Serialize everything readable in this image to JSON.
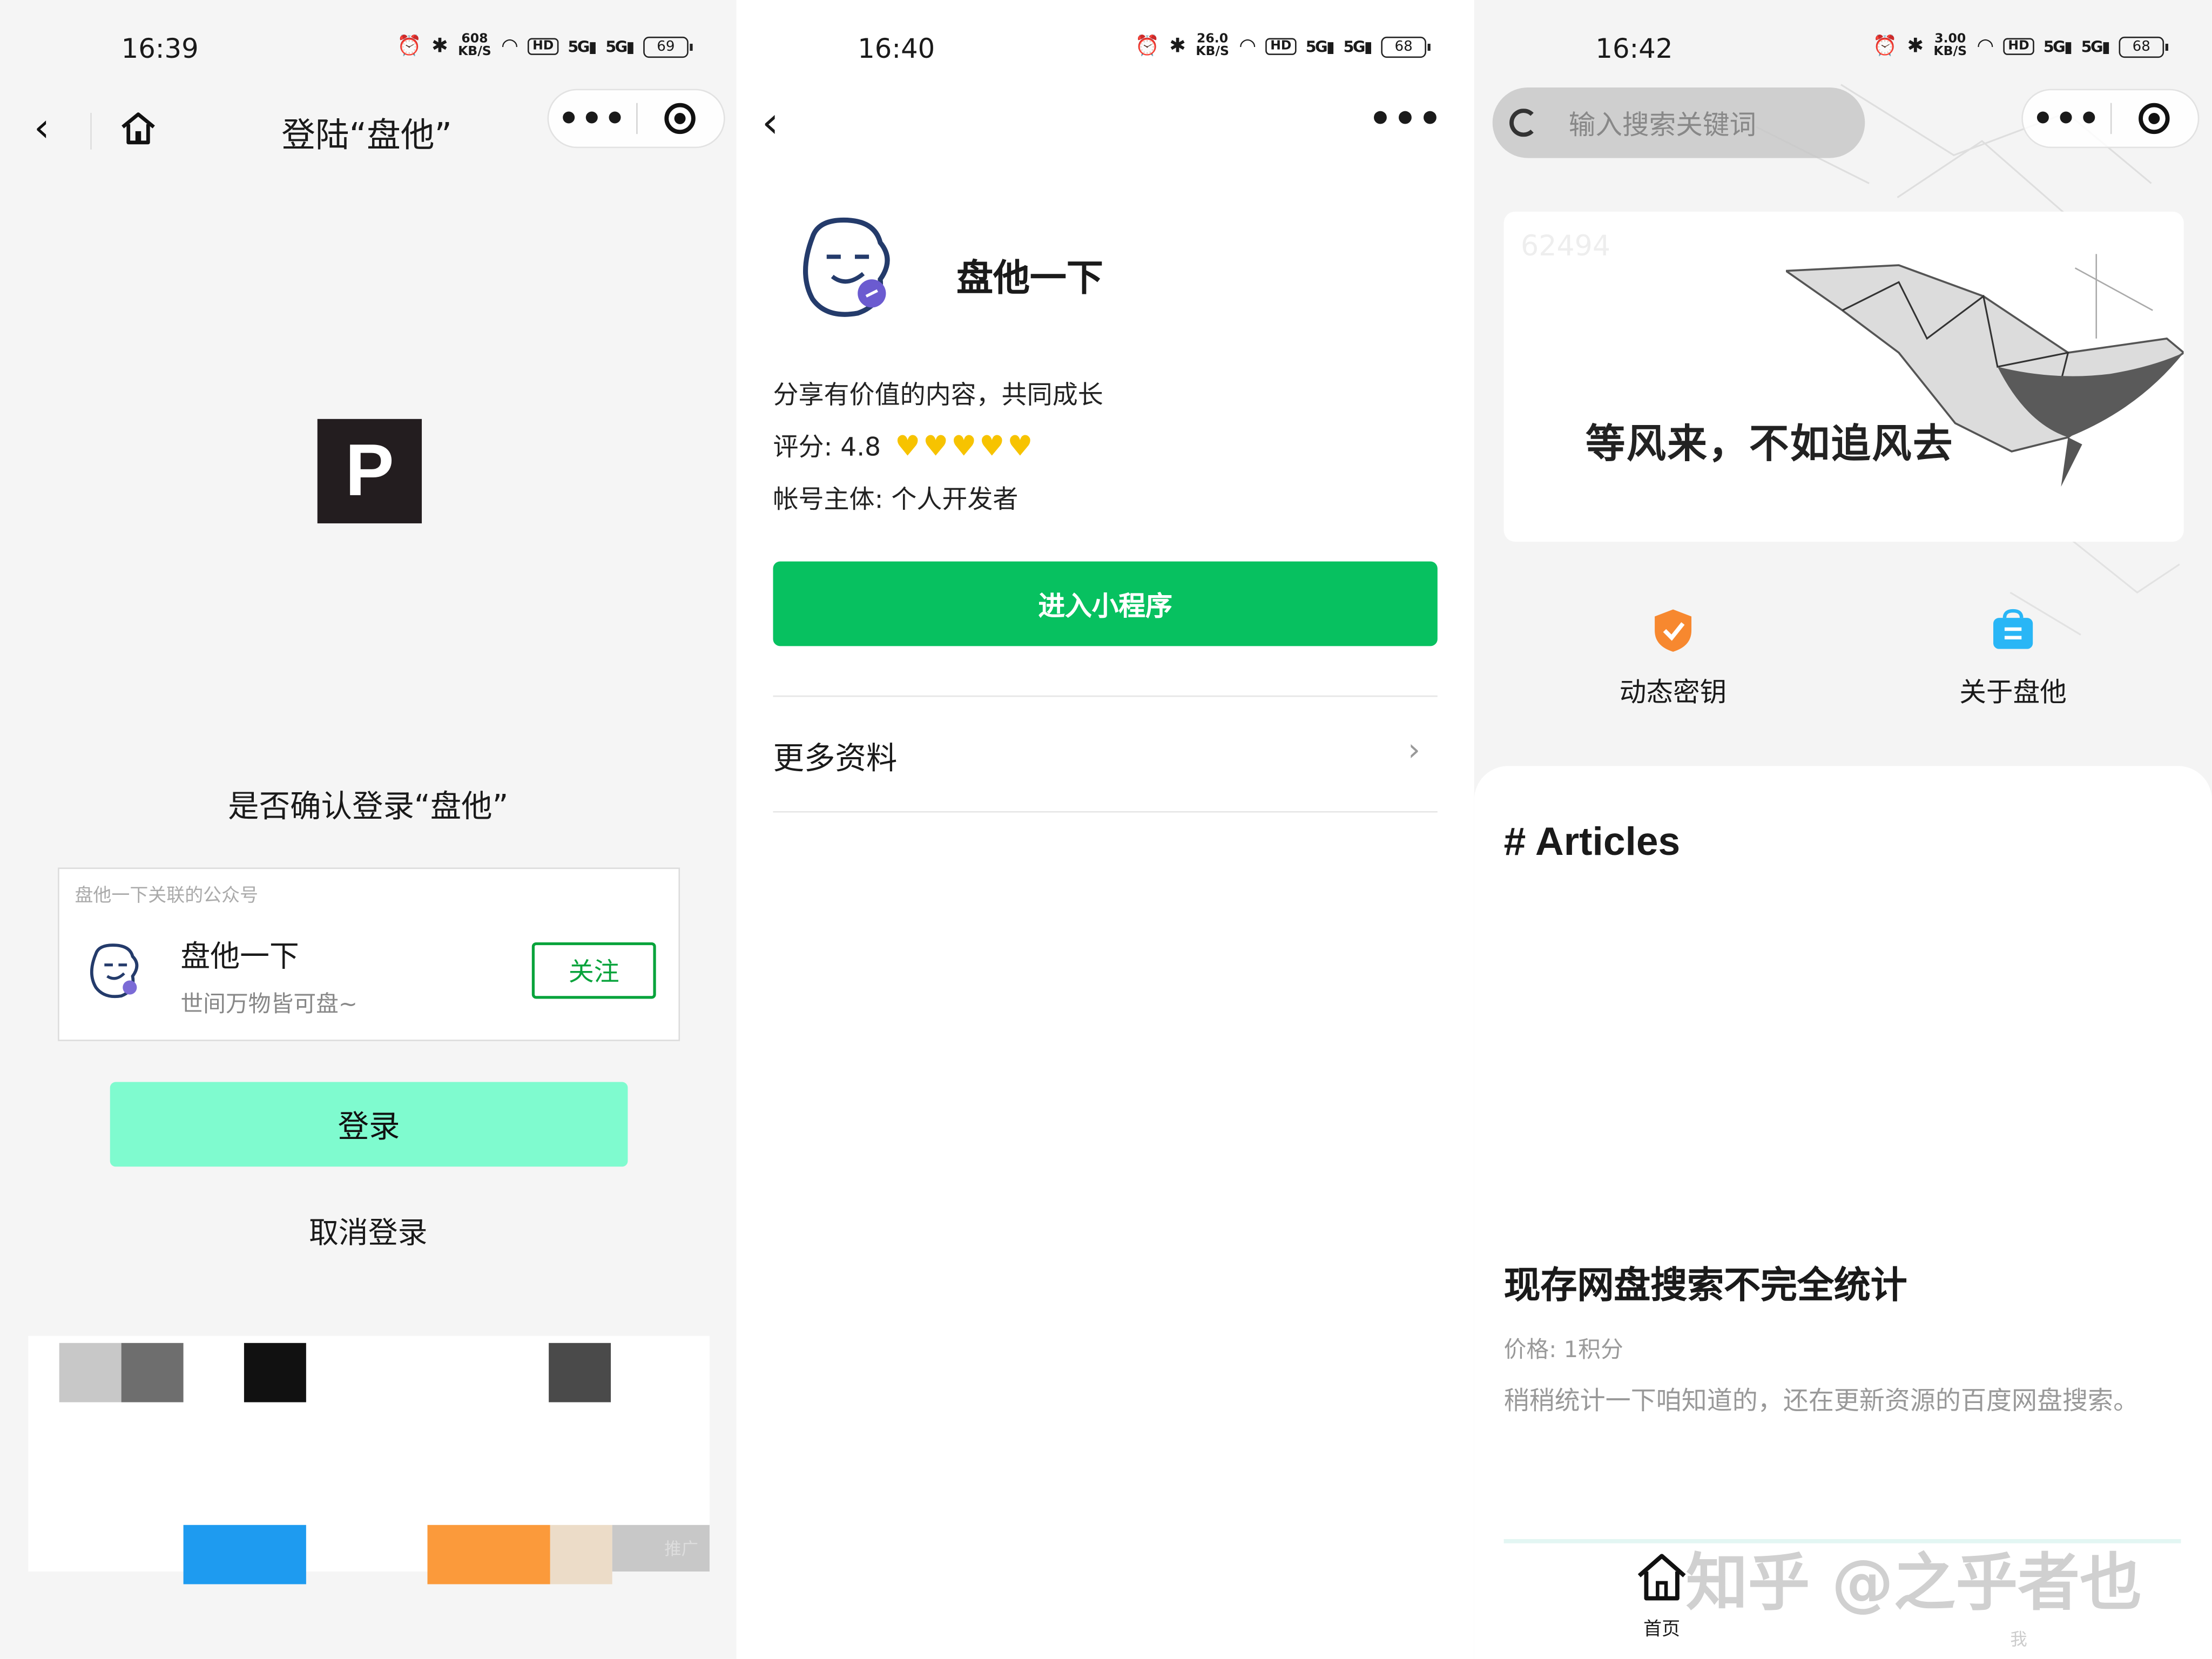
{
  "panel1": {
    "status": {
      "time": "16:39",
      "speed_top": "608",
      "speed_unit": "KB/S",
      "hd": "HD",
      "sig1": "5G",
      "sig2": "5G",
      "battery": "69"
    },
    "title": "登陆“盘他”",
    "logo_letter": "P",
    "confirm_text": "是否确认登录“盘他”",
    "account_card": {
      "header": "盘他一下关联的公众号",
      "name": "盘他一下",
      "desc": "世间万物皆可盘~",
      "follow_label": "关注"
    },
    "login_label": "登录",
    "cancel_label": "取消登录",
    "ad_tag": "推广"
  },
  "panel2": {
    "status": {
      "time": "16:40",
      "speed_top": "26.0",
      "speed_unit": "KB/S",
      "hd": "HD",
      "sig1": "5G",
      "sig2": "5G",
      "battery": "68"
    },
    "more": "•••",
    "app_name": "盘他一下",
    "description": "分享有价值的内容，共同成长",
    "rating_label": "评分: 4.8",
    "rating_value": 4.8,
    "hearts": "♥♥♥♥♥",
    "owner": "帐号主体: 个人开发者",
    "enter_label": "进入小程序",
    "more_info_label": "更多资料"
  },
  "panel3": {
    "status": {
      "time": "16:42",
      "speed_top": "3.00",
      "speed_unit": "KB/S",
      "hd": "HD",
      "sig1": "5G",
      "sig2": "5G",
      "battery": "68"
    },
    "search_placeholder": "输入搜索关键词",
    "banner_number": "62494",
    "banner_slogan": "等风来，不如追风去",
    "features": [
      {
        "label": "动态密钥",
        "icon": "shield-check-icon",
        "color": "#f7882f"
      },
      {
        "label": "关于盘他",
        "icon": "bag-info-icon",
        "color": "#29b6f6"
      }
    ],
    "articles_heading": "# Articles",
    "article": {
      "title": "现存网盘搜索不完全统计",
      "price": "价格: 1积分",
      "desc": "稍稍统计一下咱知道的，还在更新资源的百度网盘搜索。"
    },
    "tab_home": "首页",
    "tab_me": "我",
    "watermark": "知乎 @之乎者也"
  },
  "colors": {
    "wechat_green": "#07c160",
    "login_mint": "#7ffbcf",
    "follow_green": "#07a33b",
    "heart_yellow": "#f7c300"
  }
}
